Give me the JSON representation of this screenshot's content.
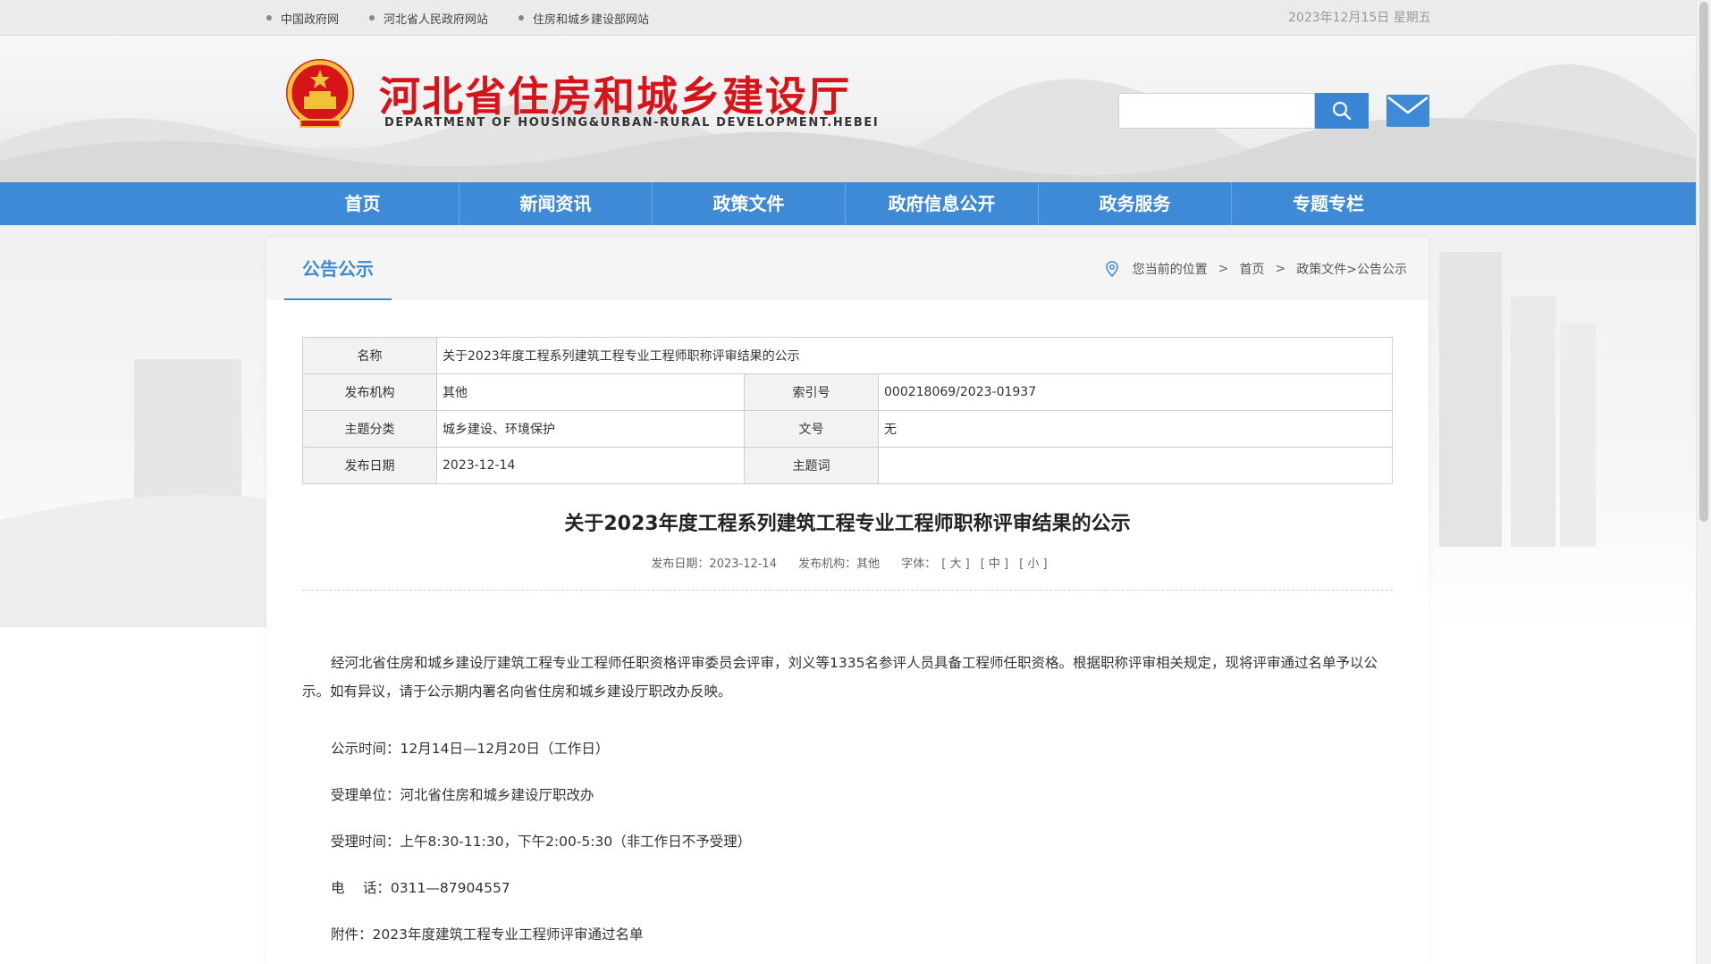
{
  "topbar": {
    "links": [
      "中国政府网",
      "河北省人民政府网站",
      "住房和城乡建设部网站"
    ],
    "date": "2023年12月15日 星期五"
  },
  "header": {
    "title": "河北省住房和城乡建设厅",
    "subtitle": "DEPARTMENT OF HOUSING&URBAN-RURAL DEVELOPMENT.HEBEI",
    "search_placeholder": ""
  },
  "nav": [
    "首页",
    "新闻资讯",
    "政策文件",
    "政府信息公开",
    "政务服务",
    "专题专栏"
  ],
  "section": {
    "title": "公告公示",
    "breadcrumb": {
      "prefix": "您当前的位置",
      "sep": ">",
      "home": "首页",
      "path": "政策文件>公告公示"
    }
  },
  "info": {
    "name_label": "名称",
    "name_value": "关于2023年度工程系列建筑工程专业工程师职称评审结果的公示",
    "publisher_label": "发布机构",
    "publisher_value": "其他",
    "index_label": "索引号",
    "index_value": "000218069/2023-01937",
    "topic_label": "主题分类",
    "topic_value": "城乡建设、环境保护",
    "docno_label": "文号",
    "docno_value": "无",
    "date_label": "发布日期",
    "date_value": "2023-12-14",
    "keyword_label": "主题词",
    "keyword_value": ""
  },
  "article": {
    "title": "关于2023年度工程系列建筑工程专业工程师职称评审结果的公示",
    "meta_date": "发布日期：2023-12-14",
    "meta_publisher": "发布机构：其他",
    "font_label": "字体：",
    "font_large": "[ 大 ]",
    "font_medium": "[ 中 ]",
    "font_small": "[ 小 ]",
    "paragraph": "经河北省住房和城乡建设厅建筑工程专业工程师任职资格评审委员会评审，刘义等1335名参评人员具备工程师任职资格。根据职称评审相关规定，现将评审通过名单予以公示。如有异议，请于公示期内署名向省住房和城乡建设厅职改办反映。",
    "public_time": "公示时间：12月14日—12月20日（工作日）",
    "unit": "受理单位：河北省住房和城乡建设厅职改办",
    "hours": "受理时间：上午8:30-11:30，下午2:00-5:30（非工作日不予受理）",
    "phone": "电　 话：0311—87904557",
    "attachment": "附件：2023年度建筑工程专业工程师评审通过名单"
  },
  "colors": {
    "brand_blue": "#3e8ad6",
    "title_red": "#d7141a"
  }
}
